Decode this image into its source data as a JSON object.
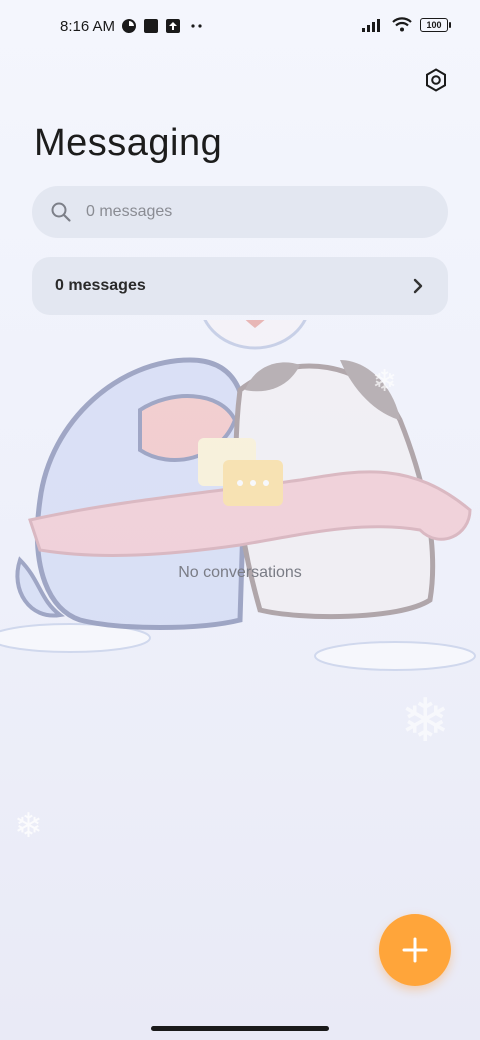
{
  "status_bar": {
    "time": "8:16 AM",
    "battery": "100",
    "icons": [
      "app-icon",
      "square-icon",
      "upload-icon",
      "more-dots-icon",
      "signal-icon",
      "wifi-icon",
      "battery-icon"
    ]
  },
  "header": {
    "title": "Messaging",
    "settings_icon": "settings-icon"
  },
  "search": {
    "placeholder": "0 messages"
  },
  "messages_row": {
    "label": "0 messages"
  },
  "empty_state": {
    "text": "No conversations"
  },
  "fab": {
    "icon": "plus-icon",
    "color": "#ffa53a"
  },
  "colors": {
    "accent": "#ffa53a",
    "background": "#f2f4fc"
  }
}
